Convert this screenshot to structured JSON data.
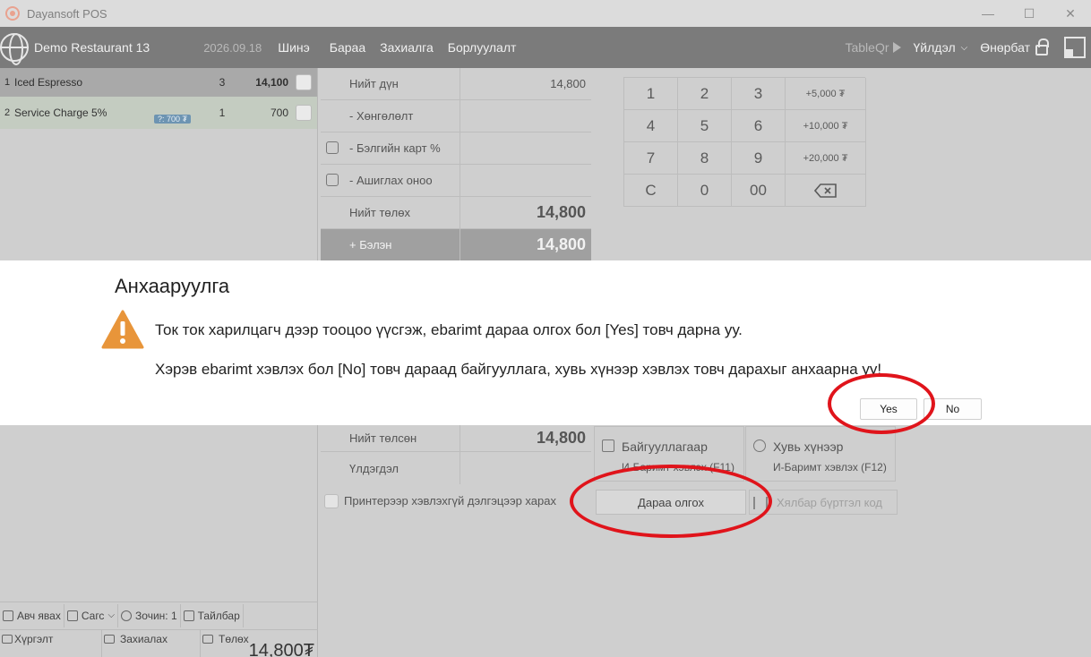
{
  "window": {
    "title": "Dayansoft POS",
    "controls": [
      "—",
      "☐",
      "✕"
    ]
  },
  "topnav": {
    "restaurant": "Demo Restaurant 13",
    "date": "2026.09.18",
    "items": [
      "Шинэ",
      "Бараа",
      "Захиалга",
      "Борлуулалт"
    ],
    "tableqr": "TableQr",
    "operations": "Үйлдэл",
    "user": "Өнөрбат"
  },
  "order": {
    "rows": [
      {
        "idx": "1",
        "name": "Iced Espresso",
        "qty": "3",
        "price": "14,100"
      },
      {
        "idx": "2",
        "name": "Service Charge 5%",
        "qty": "1",
        "price": "700",
        "tag": "?: 700 ₮"
      }
    ]
  },
  "summary": {
    "rows": [
      {
        "label": "Нийт дүн",
        "value": "14,800"
      },
      {
        "label": "- Хөнгөлөлт",
        "value": ""
      },
      {
        "label": "- Бэлгийн карт %",
        "value": ""
      },
      {
        "label": "- Ашиглах оноо",
        "value": ""
      },
      {
        "label": "Нийт төлөх",
        "value": "14,800"
      },
      {
        "label": "+ Бэлэн",
        "value": "14,800"
      }
    ]
  },
  "keypad": {
    "keys": [
      "1",
      "2",
      "3",
      "+5,000 ₮",
      "4",
      "5",
      "6",
      "+10,000 ₮",
      "7",
      "8",
      "9",
      "+20,000 ₮",
      "C",
      "0",
      "00",
      ""
    ]
  },
  "dialog": {
    "title": "Анхааруулга",
    "message1": "Ток ток харилцагч дээр тооцоо үүсгэж, ebarimt дараа олгох бол [Yes] товч дарна уу.",
    "message2": "Хэрэв ebarimt хэвлэх бол [No] товч дараад байгууллага, хувь хүнээр хэвлэх товч дарахыг анхаарна уу!",
    "yes": "Yes",
    "no": "No"
  },
  "payment": {
    "paid_label": "Нийт төлсөн",
    "paid_value": "14,800",
    "remaining_label": "Үлдэгдэл",
    "org_title": "Байгууллагаар",
    "org_sub": "И-Баримт хэвлэх (F11)",
    "person_title": "Хувь хүнээр",
    "person_sub": "И-Баримт хэвлэх (F12)",
    "later": "Дараа олгох",
    "easy_reg": "Хялбар бүртгэл код",
    "printer_option": "Принтерээр хэвлэхгүй дэлгэцээр харах"
  },
  "bottom": {
    "takeaway": "Авч явах",
    "cart": "Сагс",
    "guest": "Зочин: 1",
    "note": "Тайлбар",
    "delivery": "Хүргэлт",
    "ordering": "Захиалах",
    "payment": "Төлөх",
    "total": "14,800₮"
  },
  "colors": {
    "annotation": "#e0141b",
    "nav_bg": "#7b7b7b",
    "warning": "#e8953a"
  }
}
